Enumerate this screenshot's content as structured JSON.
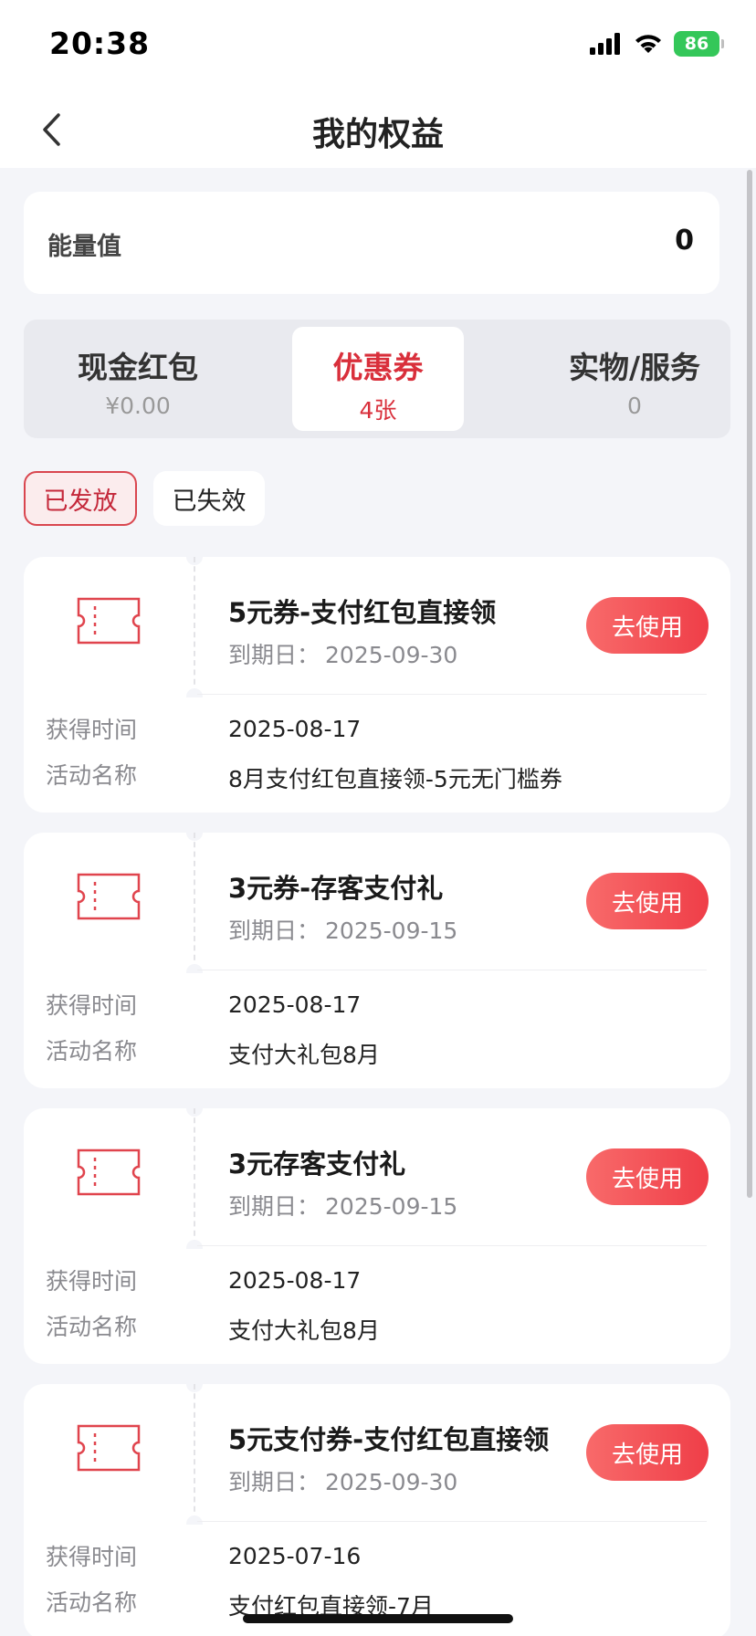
{
  "status_bar": {
    "time": "20:38",
    "battery": "86"
  },
  "nav": {
    "title": "我的权益"
  },
  "energy": {
    "label": "能量值",
    "value": "0"
  },
  "tabs": [
    {
      "label": "现金红包",
      "sub": "¥0.00"
    },
    {
      "label": "优惠券",
      "sub": "4张"
    },
    {
      "label": "实物/服务",
      "sub": "0"
    }
  ],
  "filters": [
    {
      "label": "已发放"
    },
    {
      "label": "已失效"
    }
  ],
  "coupon_labels": {
    "expire_label": "到期日：",
    "obtain_label": "获得时间",
    "activity_label": "活动名称",
    "use_button": "去使用"
  },
  "coupons": [
    {
      "title": "5元券-支付红包直接领",
      "expire": "2025-09-30",
      "obtained": "2025-08-17",
      "activity": "8月支付红包直接领-5元无门槛券"
    },
    {
      "title": "3元券-存客支付礼",
      "expire": "2025-09-15",
      "obtained": "2025-08-17",
      "activity": "支付大礼包8月"
    },
    {
      "title": "3元存客支付礼",
      "expire": "2025-09-15",
      "obtained": "2025-08-17",
      "activity": "支付大礼包8月"
    },
    {
      "title": "5元支付券-支付红包直接领",
      "expire": "2025-09-30",
      "obtained": "2025-07-16",
      "activity": "支付红包直接领-7月"
    }
  ],
  "colors": {
    "accent": "#d92f3b",
    "button_gradient_start": "#f86a6a",
    "button_gradient_end": "#ef3e48",
    "background": "#f4f5f9"
  },
  "icons": [
    "back-icon",
    "signal-icon",
    "wifi-icon",
    "battery-icon",
    "ticket-icon"
  ]
}
